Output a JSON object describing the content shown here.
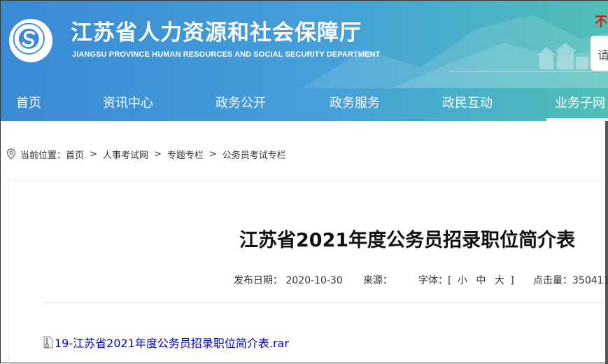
{
  "header": {
    "title": "江苏省人力资源和社会保障厅",
    "subtitle": "JIANGSU PROVINCE HUMAN RESOURCES AND SOCIAL SECURITY DEPARTMENT",
    "slogan_fragment": "不",
    "search_placeholder": "请",
    "logo": "jiangsu-hrss-emblem"
  },
  "nav": {
    "items": [
      {
        "label": "首页"
      },
      {
        "label": "资讯中心"
      },
      {
        "label": "政务公开"
      },
      {
        "label": "政务服务"
      },
      {
        "label": "政民互动"
      },
      {
        "label": "业务子网",
        "active": true
      }
    ]
  },
  "breadcrumb": {
    "prefix": "当前位置：",
    "items": [
      "首页",
      "人事考试网",
      "专题专栏",
      "公务员考试专栏"
    ],
    "separator": ">"
  },
  "article": {
    "title": "江苏省2021年度公务员招录职位简介表",
    "publish_label": "发布日期：",
    "publish_date": "2020-10-30",
    "source_label": "来源：",
    "source_value": "",
    "font_label": "字体：[",
    "font_small": "小",
    "font_medium": "中",
    "font_large": "大",
    "font_close": "]",
    "hits_label": "点击量：",
    "hits_value": "350411"
  },
  "attachment": {
    "filename": "19-江苏省2021年度公务员招录职位简介表.rar",
    "icon": "rar-file-icon"
  },
  "colors": {
    "header_start": "#3a8ad6",
    "header_end": "#4fbeb5",
    "link": "#0000cc",
    "slogan": "#d81e06"
  }
}
